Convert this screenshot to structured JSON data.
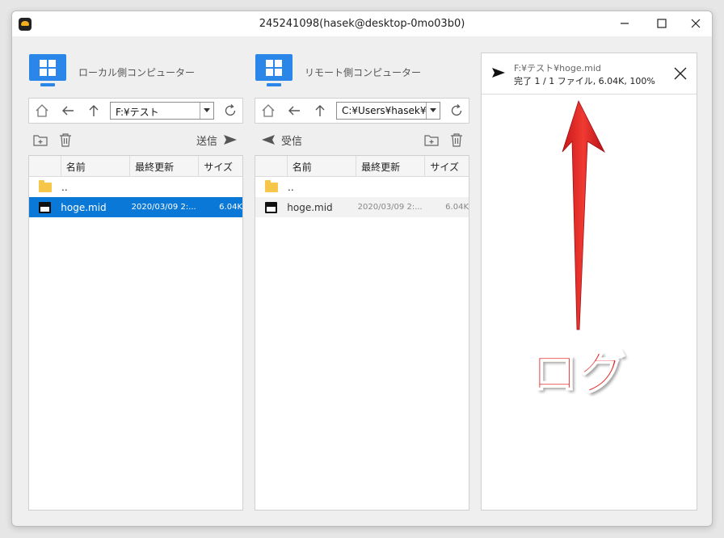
{
  "window": {
    "title": "245241098(hasek@desktop-0mo03b0)",
    "minimize": "—",
    "maximize": "☐",
    "close": "✕"
  },
  "local": {
    "title": "ローカル側コンピューター",
    "path": "F:¥テスト",
    "send_label": "送信",
    "columns": [
      "名前",
      "最終更新",
      "サイズ"
    ],
    "rows": [
      {
        "name": "..",
        "modified": "",
        "size": "",
        "type": "folder"
      },
      {
        "name": "hoge.mid",
        "modified": "2020/03/09 2:...",
        "size": "6.04K",
        "type": "midi"
      }
    ]
  },
  "remote": {
    "title": "リモート側コンピューター",
    "path": "C:¥Users¥hasek¥Do",
    "receive_label": "受信",
    "columns": [
      "名前",
      "最終更新",
      "サイズ"
    ],
    "rows": [
      {
        "name": "..",
        "modified": "",
        "size": "",
        "type": "folder"
      },
      {
        "name": "hoge.mid",
        "modified": "2020/03/09 2:...",
        "size": "6.04K",
        "type": "midi"
      }
    ]
  },
  "log": {
    "path": "F:¥テスト¥hoge.mid",
    "status": "完了 1 / 1 ファイル, 6.04K, 100%"
  },
  "annotation": {
    "label": "ログ",
    "color": "#e6211f"
  },
  "colors": {
    "accent": "#2a86e8",
    "selection": "#0a78d7",
    "folder": "#f6c64b"
  }
}
